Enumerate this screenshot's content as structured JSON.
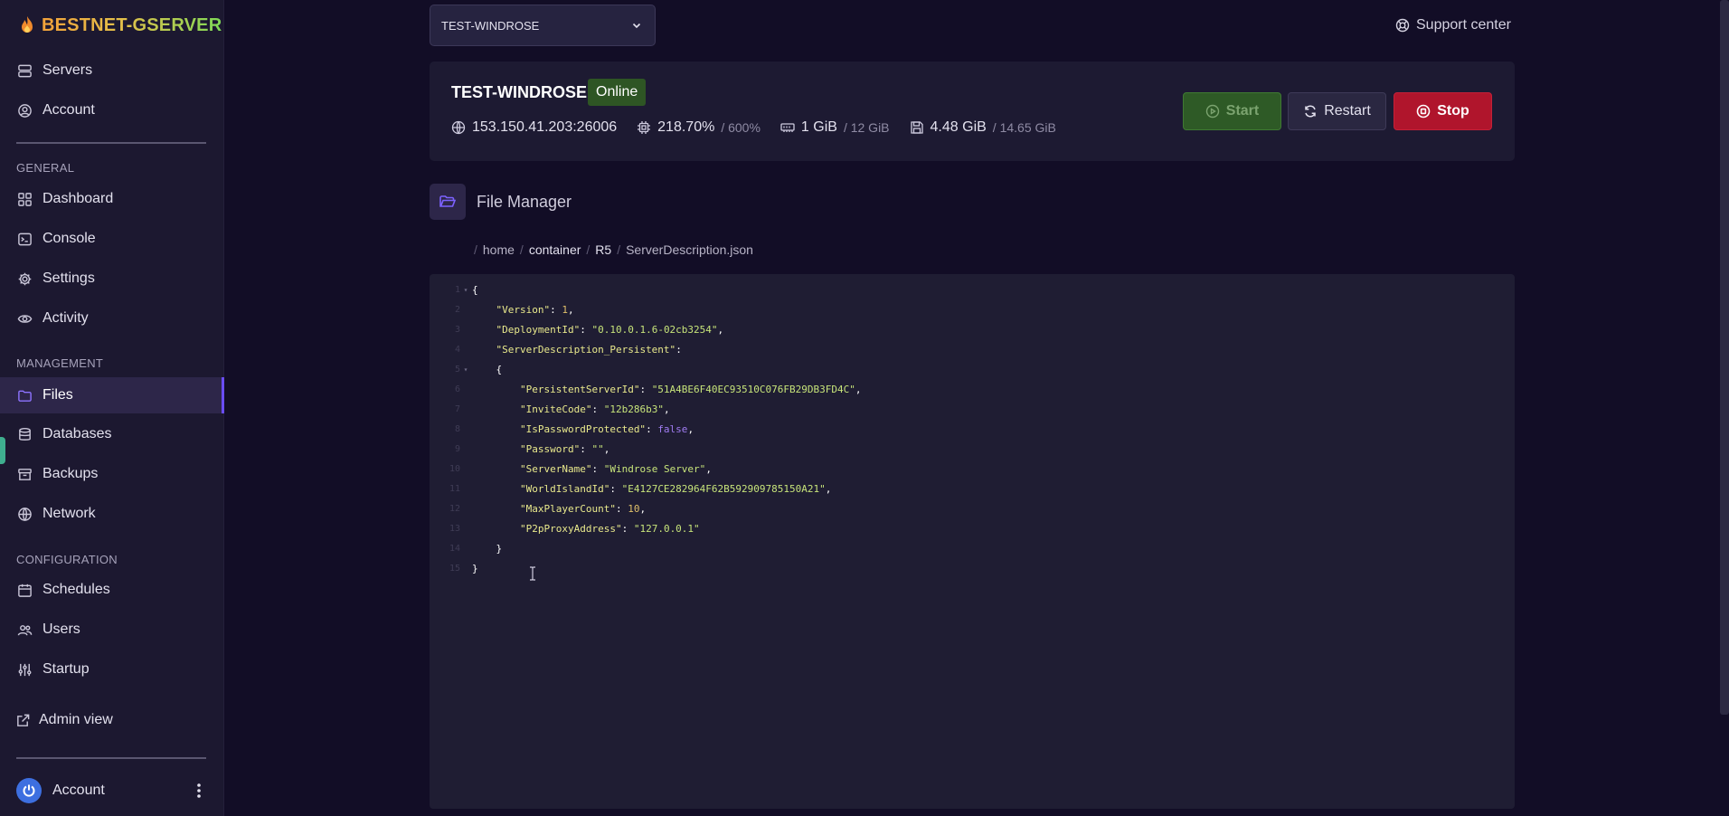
{
  "brand": {
    "name": "BESTNET-GSERVER"
  },
  "sidebar": {
    "top_items": [
      {
        "label": "Servers",
        "icon": "server-icon"
      },
      {
        "label": "Account",
        "icon": "user-circle-icon"
      }
    ],
    "sections": [
      {
        "title": "GENERAL",
        "items": [
          {
            "label": "Dashboard",
            "icon": "grid-icon"
          },
          {
            "label": "Console",
            "icon": "terminal-icon"
          },
          {
            "label": "Settings",
            "icon": "gear-icon"
          },
          {
            "label": "Activity",
            "icon": "eye-icon"
          }
        ]
      },
      {
        "title": "MANAGEMENT",
        "items": [
          {
            "label": "Files",
            "icon": "folder-icon",
            "active": true
          },
          {
            "label": "Databases",
            "icon": "database-icon"
          },
          {
            "label": "Backups",
            "icon": "archive-icon"
          },
          {
            "label": "Network",
            "icon": "globe-icon"
          }
        ]
      },
      {
        "title": "CONFIGURATION",
        "items": [
          {
            "label": "Schedules",
            "icon": "calendar-icon"
          },
          {
            "label": "Users",
            "icon": "users-icon"
          },
          {
            "label": "Startup",
            "icon": "sliders-icon"
          }
        ]
      }
    ],
    "admin_view": "Admin view",
    "footer_account": "Account"
  },
  "topbar": {
    "server_select_value": "TEST-WINDROSE",
    "support_label": "Support center"
  },
  "server": {
    "name": "TEST-WINDROSE",
    "status": "Online",
    "address": "153.150.41.203:26006",
    "cpu": "218.70%",
    "cpu_limit": "/ 600%",
    "memory": "1 GiB",
    "memory_limit": "/ 12 GiB",
    "disk": "4.48 GiB",
    "disk_limit": "/ 14.65 GiB",
    "buttons": {
      "start": "Start",
      "restart": "Restart",
      "stop": "Stop"
    }
  },
  "file_manager": {
    "title": "File Manager",
    "breadcrumb": [
      "home",
      "container",
      "R5",
      "ServerDescription.json"
    ]
  },
  "editor": {
    "lines": [
      "{",
      "    \"Version\": 1,",
      "    \"DeploymentId\": \"0.10.0.1.6-02cb3254\",",
      "    \"ServerDescription_Persistent\":",
      "    {",
      "        \"PersistentServerId\": \"51A4BE6F40EC93510C076FB29DB3FD4C\",",
      "        \"InviteCode\": \"12b286b3\",",
      "        \"IsPasswordProtected\": false,",
      "        \"Password\": \"\",",
      "        \"ServerName\": \"Windrose Server\",",
      "        \"WorldIslandId\": \"E4127CE282964F62B592909785150A21\",",
      "        \"MaxPlayerCount\": 10,",
      "        \"P2pProxyAddress\": \"127.0.0.1\"",
      "    }",
      "}"
    ]
  },
  "colors": {
    "background": "#120d26",
    "sidebar": "#1c1830",
    "accent": "#6a4cf6",
    "online": "#2e5524",
    "start": "#2e5a26",
    "stop": "#b0152c"
  }
}
